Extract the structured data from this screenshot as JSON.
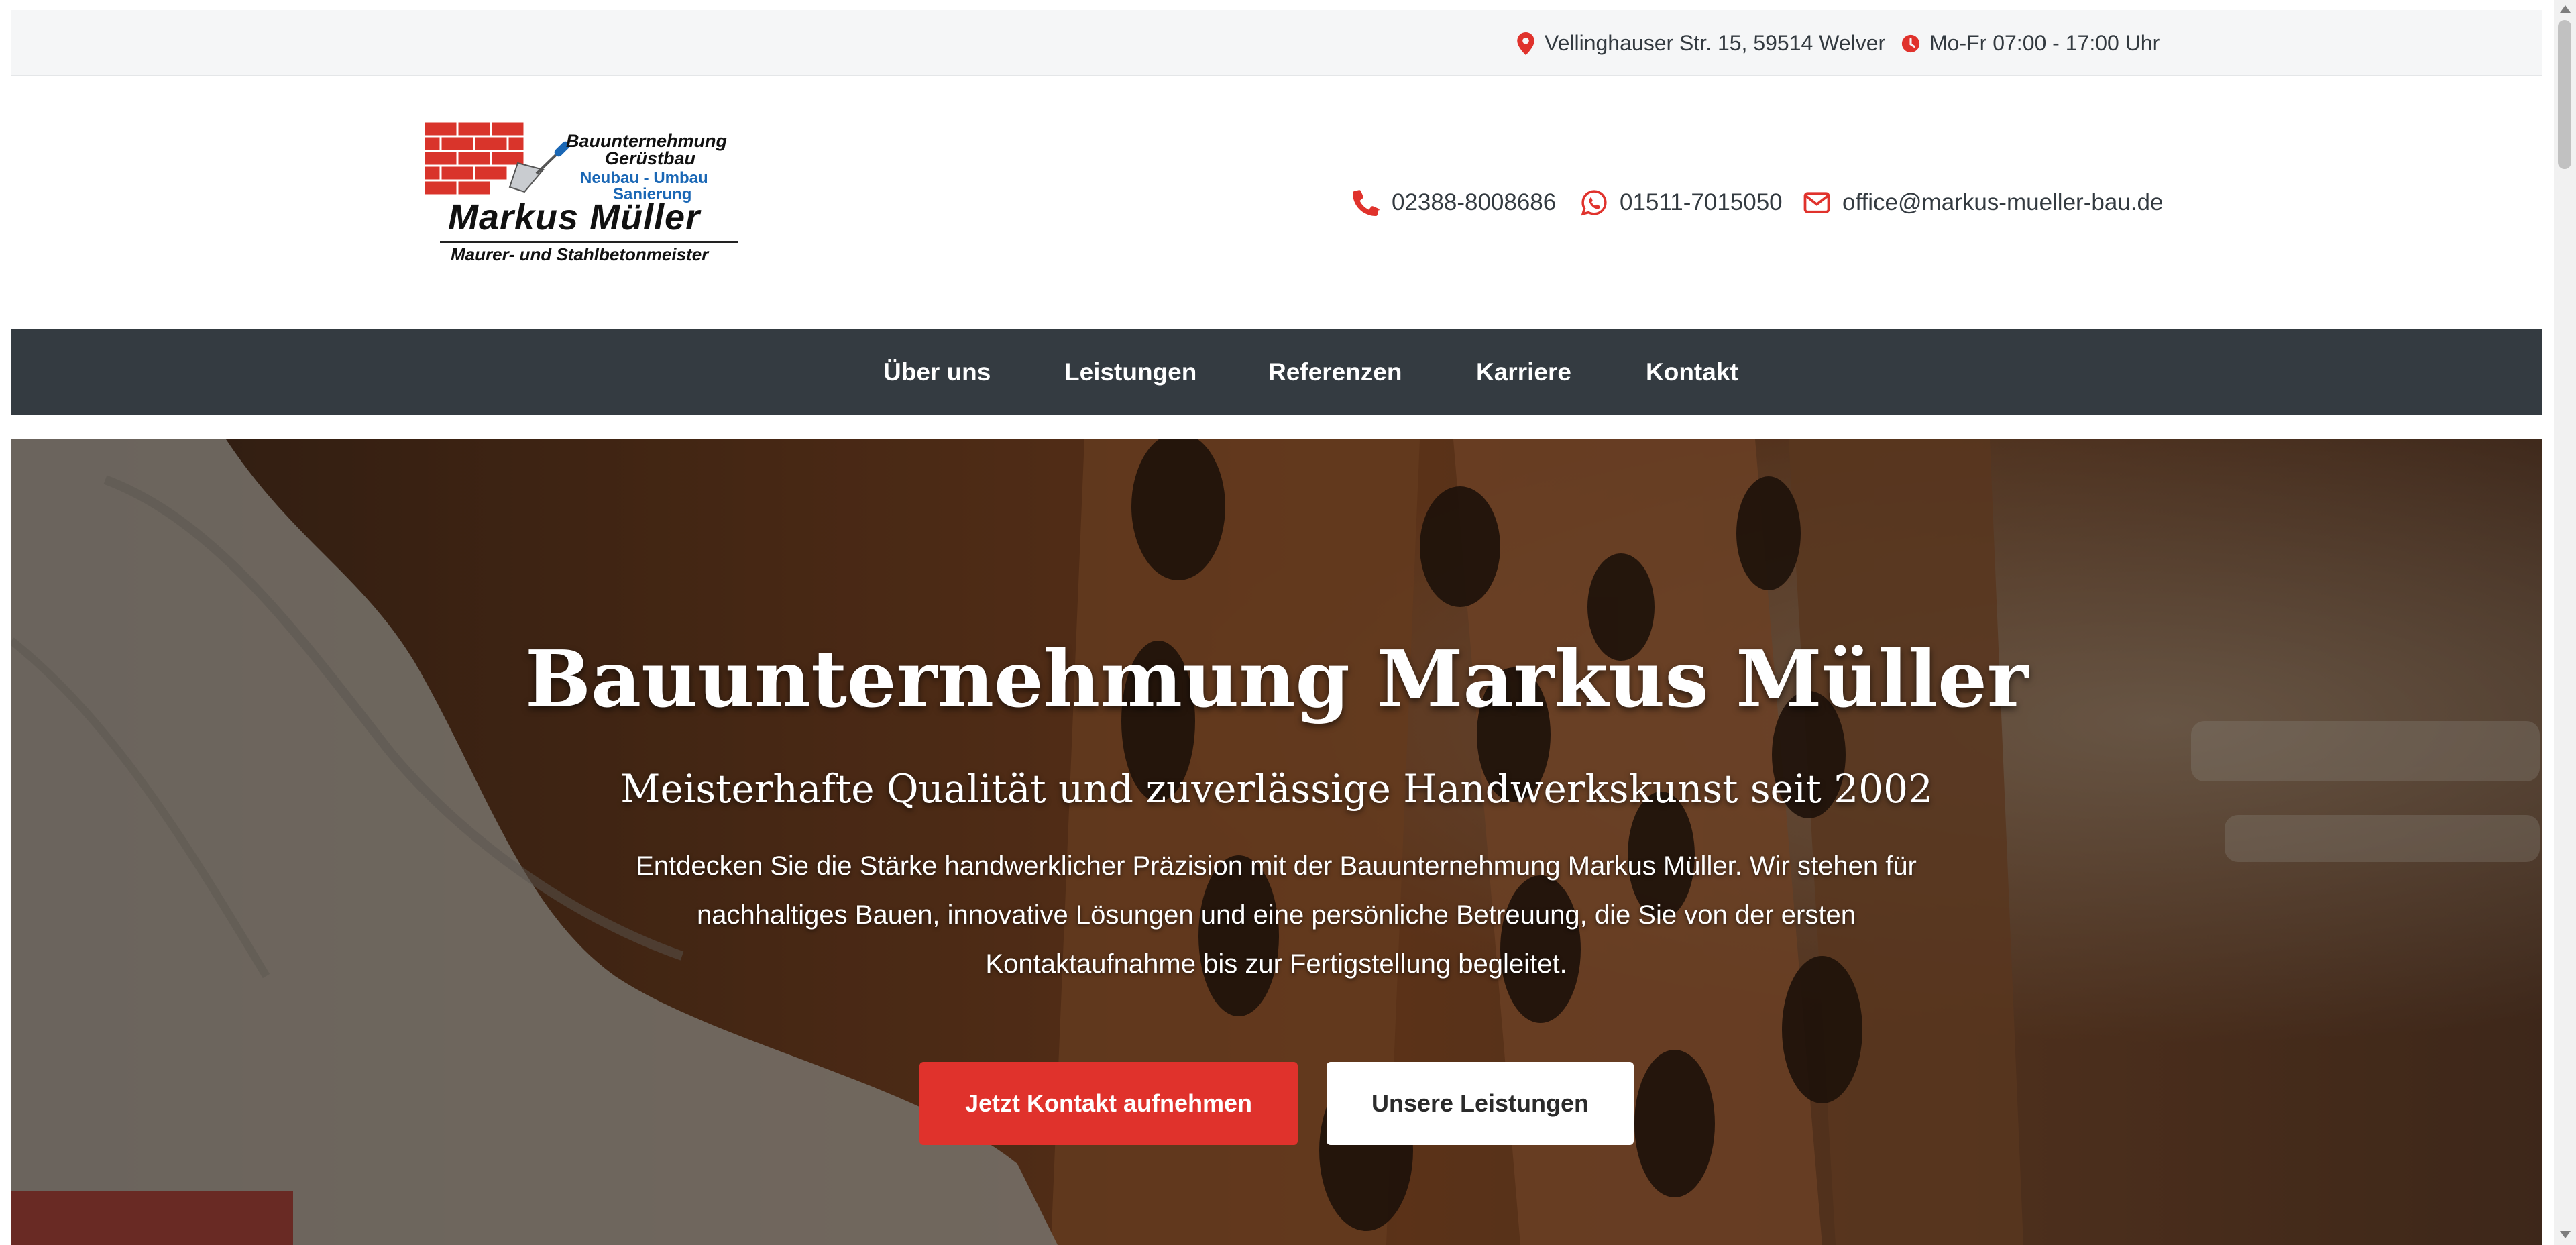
{
  "topbar": {
    "address": "Vellinghauser Str. 15, 59514 Welver",
    "hours": "Mo-Fr 07:00 - 17:00 Uhr"
  },
  "logo": {
    "line1": "Bauunternehmung",
    "line2": "Gerüstbau",
    "line3": "Neubau - Umbau",
    "line4": "Sanierung",
    "name": "Markus Müller",
    "subtitle": "Maurer- und Stahlbetonmeister"
  },
  "contacts": {
    "phone": "02388-8008686",
    "whatsapp": "01511-7015050",
    "email": "office@markus-mueller-bau.de"
  },
  "nav": {
    "items": [
      "Über uns",
      "Leistungen",
      "Referenzen",
      "Karriere",
      "Kontakt"
    ]
  },
  "hero": {
    "title": "Bauunternehmung Markus Müller",
    "subtitle": "Meisterhafte Qualität und zuverlässige Handwerkskunst seit 2002",
    "text": "Entdecken Sie die Stärke handwerklicher Präzision mit der Bauunternehmung Markus Müller. Wir stehen für nachhaltiges Bauen, innovative Lösungen und eine persönliche Betreuung, die Sie von der ersten Kontaktaufnahme bis zur Fertigstellung begleitet.",
    "cta_primary": "Jetzt Kontakt aufnehmen",
    "cta_secondary": "Unsere Leistungen"
  },
  "colors": {
    "accent": "#e0322c",
    "nav_bg": "#343b41",
    "topbar_bg": "#f5f6f7",
    "logo_blue": "#1a67b5",
    "text_dark": "#333a40"
  },
  "icons": {
    "address": "map-pin-icon",
    "hours": "clock-icon",
    "phone": "phone-icon",
    "whatsapp": "whatsapp-icon",
    "email": "envelope-icon"
  }
}
